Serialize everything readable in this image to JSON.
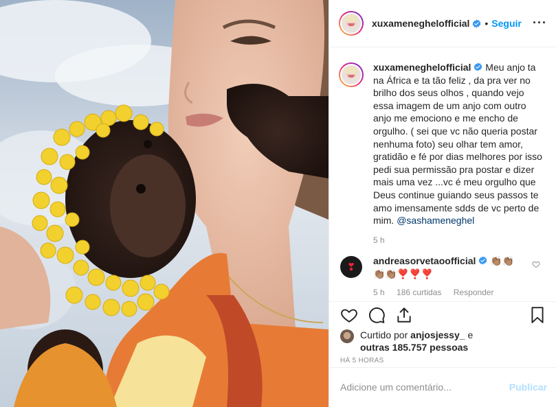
{
  "header": {
    "username": "xuxameneghelofficial",
    "separator": "•",
    "follow_label": "Seguir",
    "more_label": "···",
    "verified_icon": "verified-badge-icon",
    "more_icon": "more-options-icon"
  },
  "caption": {
    "username": "xuxameneghelofficial",
    "text": "Meu anjo ta na África e ta tão feliz , da pra ver no brilho dos seus olhos , quando vejo essa imagem de um anjo com outro anjo me emociono e me encho de orgulho. ( sei que vc não queria postar nenhuma foto) seu olhar tem amor, gratidão e fé por dias melhores por isso pedi sua permissão pra postar e dizer mais uma vez ...vc é meu orgulho que Deus continue guiando seus passos te amo imensamente sdds de vc perto de mim.",
    "mention": "@sashameneghel",
    "time": "5 h"
  },
  "comment": {
    "username": "andreasorvetaoofficial",
    "text_line1": "👏🏽👏🏽",
    "text_line2": "👏🏽👏🏽❣️❣️❣️",
    "avatar_symbol": "❣",
    "time": "5 h",
    "likes": "186 curtidas",
    "reply_label": "Responder"
  },
  "actions": {
    "icons": [
      "heart-icon",
      "comment-icon",
      "share-icon",
      "bookmark-icon"
    ]
  },
  "likes": {
    "prefix": "Curtido por",
    "first_user": "anjosjessy_",
    "conj": "e",
    "others": "outras 185.757 pessoas"
  },
  "posted_ago": "HÁ 5 HORAS",
  "add_comment": {
    "placeholder": "Adicione um comentário...",
    "publish_label": "Publicar"
  },
  "colors": {
    "accent": "#0095f6",
    "publish_disabled": "#b2dffc",
    "muted": "#8e8e8e",
    "text": "#262626"
  }
}
